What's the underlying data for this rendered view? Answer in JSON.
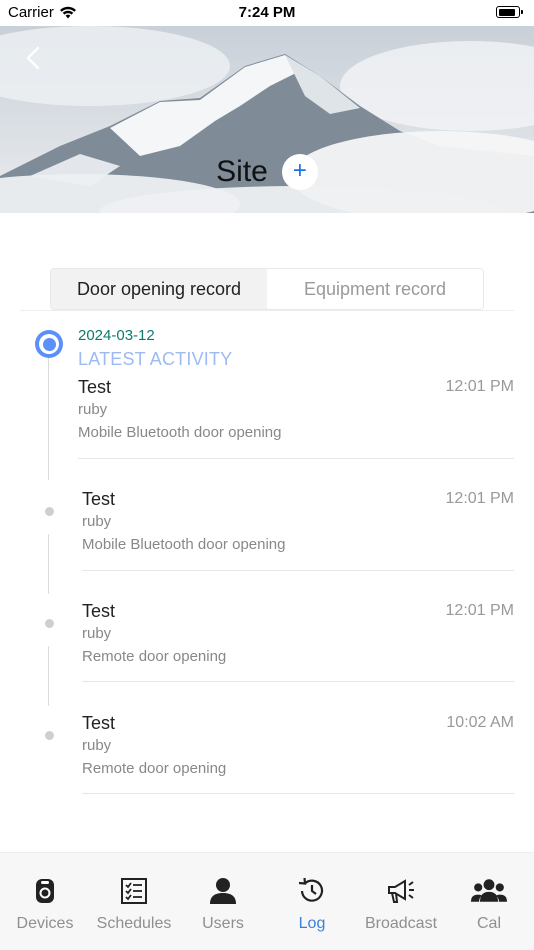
{
  "status_bar": {
    "carrier": "Carrier",
    "time": "7:24 PM"
  },
  "header": {
    "title": "Site",
    "add_symbol": "+"
  },
  "tabs": [
    {
      "label": "Door opening record",
      "active": true
    },
    {
      "label": "Equipment record",
      "active": false
    }
  ],
  "timeline": {
    "date": "2024-03-12",
    "latest_label": "LATEST ACTIVITY",
    "entries": [
      {
        "name": "Test",
        "user": "ruby",
        "method": "Mobile Bluetooth door opening",
        "time": "12:01 PM"
      },
      {
        "name": "Test",
        "user": "ruby",
        "method": "Mobile Bluetooth door opening",
        "time": "12:01 PM"
      },
      {
        "name": "Test",
        "user": "ruby",
        "method": "Remote door opening",
        "time": "12:01 PM"
      },
      {
        "name": "Test",
        "user": "ruby",
        "method": "Remote door opening",
        "time": "10:02 AM"
      }
    ]
  },
  "bottom_nav": {
    "items": [
      {
        "label": "Devices",
        "icon": "device-icon"
      },
      {
        "label": "Schedules",
        "icon": "schedule-icon"
      },
      {
        "label": "Users",
        "icon": "user-icon"
      },
      {
        "label": "Log",
        "icon": "history-icon",
        "active": true
      },
      {
        "label": "Broadcast",
        "icon": "megaphone-icon"
      },
      {
        "label": "Cal",
        "icon": "group-icon"
      }
    ]
  },
  "colors": {
    "accent": "#3b82d9",
    "timeline_dot": "#5b8ff9",
    "date_text": "#0f7a6b",
    "latest_text": "#9dbaf2"
  }
}
